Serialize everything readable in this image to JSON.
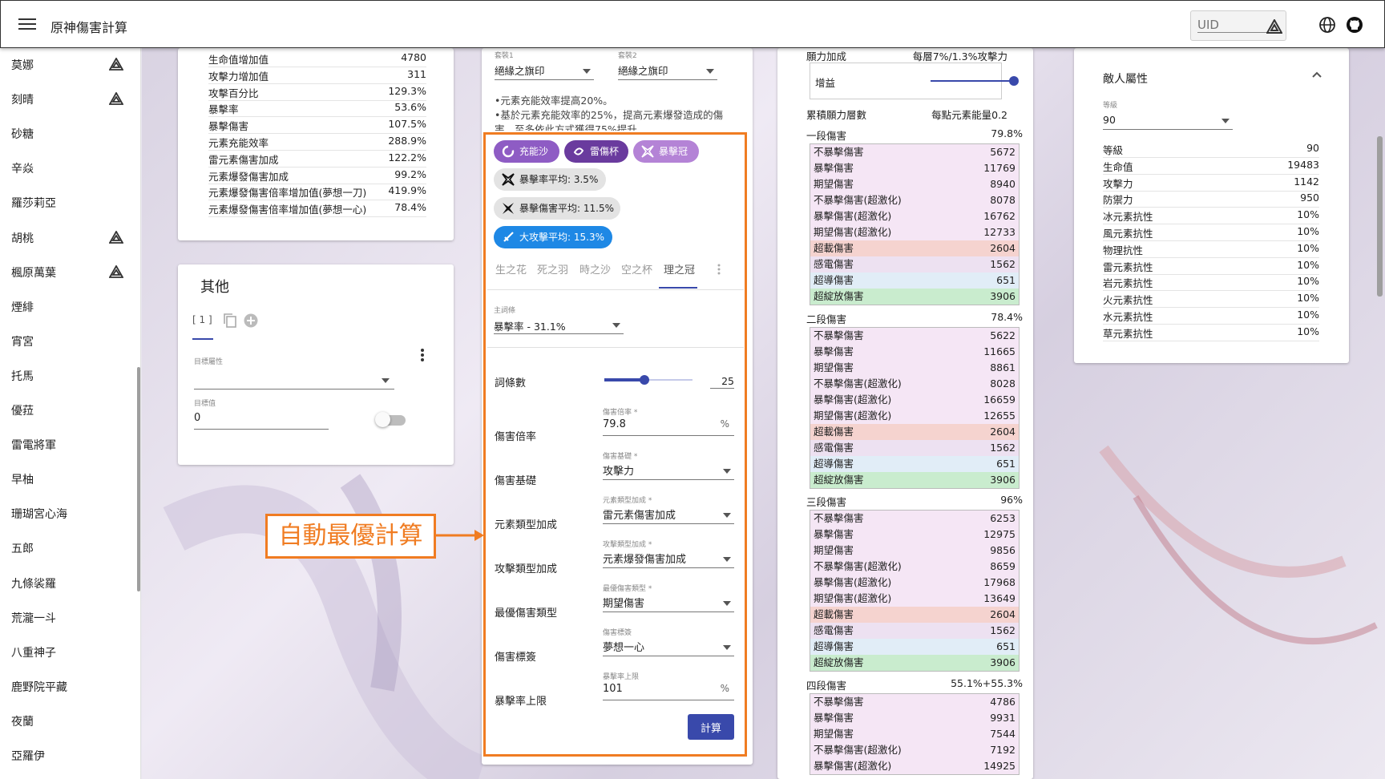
{
  "app": {
    "title": "原神傷害計算"
  },
  "topbar": {
    "uid_placeholder": "UID"
  },
  "sidebar": {
    "items": [
      {
        "label": "莫娜",
        "has_icon": true
      },
      {
        "label": "刻晴",
        "has_icon": true
      },
      {
        "label": "砂糖",
        "has_icon": false
      },
      {
        "label": "辛焱",
        "has_icon": false
      },
      {
        "label": "羅莎莉亞",
        "has_icon": false
      },
      {
        "label": "胡桃",
        "has_icon": true
      },
      {
        "label": "楓原萬葉",
        "has_icon": true
      },
      {
        "label": "煙緋",
        "has_icon": false
      },
      {
        "label": "宵宮",
        "has_icon": false
      },
      {
        "label": "托馬",
        "has_icon": false
      },
      {
        "label": "優菈",
        "has_icon": false
      },
      {
        "label": "雷電將軍",
        "has_icon": false
      },
      {
        "label": "早柚",
        "has_icon": false
      },
      {
        "label": "珊瑚宮心海",
        "has_icon": false
      },
      {
        "label": "五郎",
        "has_icon": false
      },
      {
        "label": "九條裟羅",
        "has_icon": false
      },
      {
        "label": "荒瀧一斗",
        "has_icon": false
      },
      {
        "label": "八重神子",
        "has_icon": false
      },
      {
        "label": "鹿野院平藏",
        "has_icon": false
      },
      {
        "label": "夜蘭",
        "has_icon": false
      },
      {
        "label": "亞羅伊",
        "has_icon": false
      }
    ]
  },
  "stats": {
    "rows": [
      {
        "label": "生命值增加值",
        "value": "4780"
      },
      {
        "label": "攻擊力增加值",
        "value": "311"
      },
      {
        "label": "攻擊百分比",
        "value": "129.3%"
      },
      {
        "label": "暴擊率",
        "value": "53.6%"
      },
      {
        "label": "暴擊傷害",
        "value": "107.5%"
      },
      {
        "label": "元素充能效率",
        "value": "288.9%"
      },
      {
        "label": "雷元素傷害加成",
        "value": "122.2%"
      },
      {
        "label": "元素爆發傷害加成",
        "value": "99.2%"
      },
      {
        "label": "元素爆發傷害倍率增加值(夢想一刀)",
        "value": "419.9%"
      },
      {
        "label": "元素爆發傷害倍率增加值(夢想一心)",
        "value": "78.4%"
      }
    ]
  },
  "other": {
    "title": "其他",
    "tab": "[ 1 ]",
    "target_attr_label": "目標屬性",
    "target_value_label": "目標值",
    "target_value": "0"
  },
  "artifacts": {
    "set1_label": "套裝1",
    "set1_value": "絕緣之旗印",
    "set2_label": "套裝2",
    "set2_value": "絕緣之旗印",
    "desc1": "•元素充能效率提高20%。",
    "desc2": "•基於元素充能效率的25%，提高元素爆發造成的傷",
    "desc3": "害，至多依此方式獲得75%提升。",
    "chips": [
      "充能沙",
      "雷傷杯",
      "暴擊冠"
    ],
    "avg_chips": [
      "暴擊率平均: 3.5%",
      "暴擊傷害平均: 11.5%",
      "大攻擊平均: 15.3%"
    ],
    "tabs": [
      "生之花",
      "死之羽",
      "時之沙",
      "空之杯",
      "理之冠"
    ],
    "main_stat_label": "主詞條",
    "main_stat_value": "暴擊率 - 31.1%",
    "substat_count_label": "詞條數",
    "substat_count": "25",
    "substat_fraction": 0.45,
    "fields": [
      {
        "label": "傷害倍率",
        "small": "傷害倍率 *",
        "value": "79.8",
        "suffix": "%",
        "dropdown": false
      },
      {
        "label": "傷害基礎",
        "small": "傷害基礎 *",
        "value": "攻擊力",
        "suffix": "",
        "dropdown": true
      },
      {
        "label": "元素類型加成",
        "small": "元素類型加成 *",
        "value": "雷元素傷害加成",
        "suffix": "",
        "dropdown": true
      },
      {
        "label": "攻擊類型加成",
        "small": "攻擊類型加成 *",
        "value": "元素爆發傷害加成",
        "suffix": "",
        "dropdown": true
      },
      {
        "label": "最優傷害類型",
        "small": "最優傷害類型 *",
        "value": "期望傷害",
        "suffix": "",
        "dropdown": true
      },
      {
        "label": "傷害標簽",
        "small": "傷害標簽",
        "value": "夢想一心",
        "suffix": "",
        "dropdown": true
      },
      {
        "label": "暴擊率上限",
        "small": "暴擊率上限",
        "value": "101",
        "suffix": "%",
        "dropdown": false
      }
    ],
    "calc_button": "計算"
  },
  "callout": "自動最優計算",
  "wish": {
    "title": "願力加成",
    "rate": "每層7%/1.3%攻擊力",
    "gain_label": "增益",
    "gain_fraction": 1.0,
    "stack_label": "累積願力層數",
    "stack_value": "每點元素能量0.2"
  },
  "damage": [
    {
      "name": "一段傷害",
      "pct": "79.8%",
      "rows": [
        {
          "label": "不暴擊傷害",
          "value": "5672",
          "tone": "pink"
        },
        {
          "label": "暴擊傷害",
          "value": "11769",
          "tone": "pink"
        },
        {
          "label": "期望傷害",
          "value": "8940",
          "tone": "pink"
        },
        {
          "label": "不暴擊傷害(超激化)",
          "value": "8078",
          "tone": "pink"
        },
        {
          "label": "暴擊傷害(超激化)",
          "value": "16762",
          "tone": "pink"
        },
        {
          "label": "期望傷害(超激化)",
          "value": "12733",
          "tone": "pink"
        },
        {
          "label": "超載傷害",
          "value": "2604",
          "tone": "red"
        },
        {
          "label": "感電傷害",
          "value": "1562",
          "tone": "lilac"
        },
        {
          "label": "超導傷害",
          "value": "651",
          "tone": "blue"
        },
        {
          "label": "超綻放傷害",
          "value": "3906",
          "tone": "green"
        }
      ]
    },
    {
      "name": "二段傷害",
      "pct": "78.4%",
      "rows": [
        {
          "label": "不暴擊傷害",
          "value": "5622",
          "tone": "pink"
        },
        {
          "label": "暴擊傷害",
          "value": "11665",
          "tone": "pink"
        },
        {
          "label": "期望傷害",
          "value": "8861",
          "tone": "pink"
        },
        {
          "label": "不暴擊傷害(超激化)",
          "value": "8028",
          "tone": "pink"
        },
        {
          "label": "暴擊傷害(超激化)",
          "value": "16659",
          "tone": "pink"
        },
        {
          "label": "期望傷害(超激化)",
          "value": "12655",
          "tone": "pink"
        },
        {
          "label": "超載傷害",
          "value": "2604",
          "tone": "red"
        },
        {
          "label": "感電傷害",
          "value": "1562",
          "tone": "lilac"
        },
        {
          "label": "超導傷害",
          "value": "651",
          "tone": "blue"
        },
        {
          "label": "超綻放傷害",
          "value": "3906",
          "tone": "green"
        }
      ]
    },
    {
      "name": "三段傷害",
      "pct": "96%",
      "rows": [
        {
          "label": "不暴擊傷害",
          "value": "6253",
          "tone": "pink"
        },
        {
          "label": "暴擊傷害",
          "value": "12975",
          "tone": "pink"
        },
        {
          "label": "期望傷害",
          "value": "9856",
          "tone": "pink"
        },
        {
          "label": "不暴擊傷害(超激化)",
          "value": "8659",
          "tone": "pink"
        },
        {
          "label": "暴擊傷害(超激化)",
          "value": "17968",
          "tone": "pink"
        },
        {
          "label": "期望傷害(超激化)",
          "value": "13649",
          "tone": "pink"
        },
        {
          "label": "超載傷害",
          "value": "2604",
          "tone": "red"
        },
        {
          "label": "感電傷害",
          "value": "1562",
          "tone": "lilac"
        },
        {
          "label": "超導傷害",
          "value": "651",
          "tone": "blue"
        },
        {
          "label": "超綻放傷害",
          "value": "3906",
          "tone": "green"
        }
      ]
    },
    {
      "name": "四段傷害",
      "pct": "55.1%+55.3%",
      "rows": [
        {
          "label": "不暴擊傷害",
          "value": "4786",
          "tone": "pink"
        },
        {
          "label": "暴擊傷害",
          "value": "9931",
          "tone": "pink"
        },
        {
          "label": "期望傷害",
          "value": "7544",
          "tone": "pink"
        },
        {
          "label": "不暴擊傷害(超激化)",
          "value": "7192",
          "tone": "pink"
        },
        {
          "label": "暴擊傷害(超激化)",
          "value": "14925",
          "tone": "pink"
        }
      ]
    }
  ],
  "enemy": {
    "title": "敵人屬性",
    "level_label": "等級",
    "level_value": "90",
    "rows": [
      {
        "label": "等級",
        "value": "90"
      },
      {
        "label": "生命值",
        "value": "19483"
      },
      {
        "label": "攻擊力",
        "value": "1142"
      },
      {
        "label": "防禦力",
        "value": "950"
      },
      {
        "label": "冰元素抗性",
        "value": "10%"
      },
      {
        "label": "風元素抗性",
        "value": "10%"
      },
      {
        "label": "物理抗性",
        "value": "10%"
      },
      {
        "label": "雷元素抗性",
        "value": "10%"
      },
      {
        "label": "岩元素抗性",
        "value": "10%"
      },
      {
        "label": "火元素抗性",
        "value": "10%"
      },
      {
        "label": "水元素抗性",
        "value": "10%"
      },
      {
        "label": "草元素抗性",
        "value": "10%"
      }
    ]
  },
  "colors": {
    "accent": "#3949ab",
    "highlight": "#f07c22",
    "chip_purple": "#8e5cc4"
  }
}
